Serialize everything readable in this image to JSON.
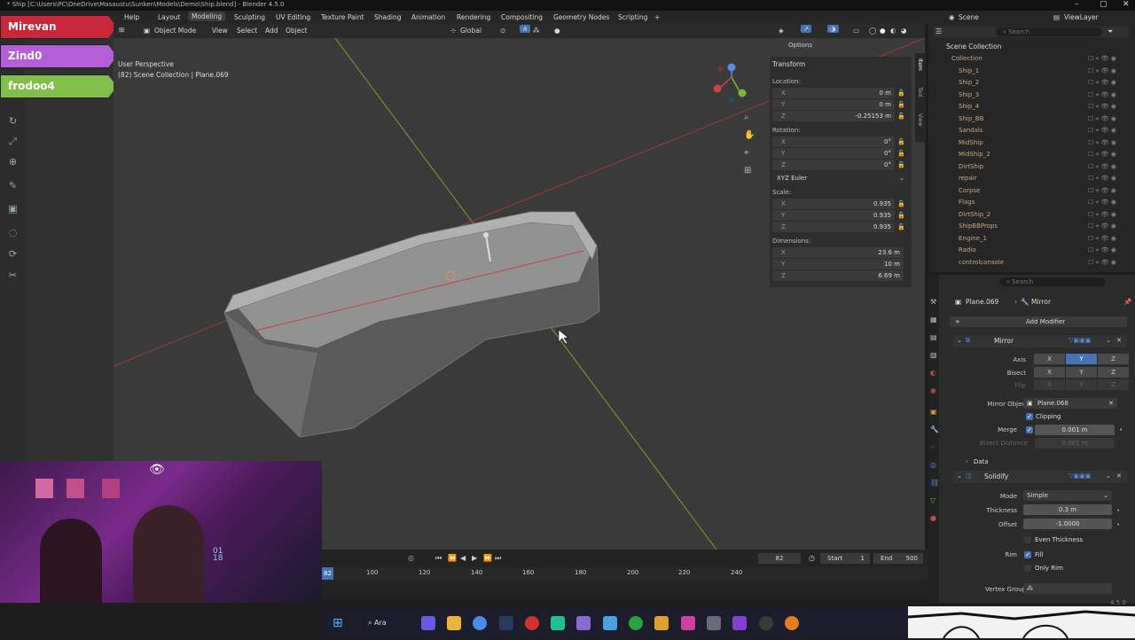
{
  "window": {
    "title": "* Ship [C:\\Users\\PC\\OneDrive\\Masaustu\\Sunken\\Models\\Demo\\Ship.blend] - Blender 4.5.0"
  },
  "menu": {
    "help": "Help",
    "workspaces": [
      "Layout",
      "Modeling",
      "Sculpting",
      "UV Editing",
      "Texture Paint",
      "Shading",
      "Animation",
      "Rendering",
      "Compositing",
      "Geometry Nodes",
      "Scripting"
    ],
    "add_tab": "+",
    "scene": "Scene",
    "view_layer": "ViewLayer"
  },
  "viewport_header": {
    "mode": "Object Mode",
    "view": "View",
    "select": "Select",
    "add": "Add",
    "object": "Object",
    "orientation": "Global",
    "options": "Options"
  },
  "viewport": {
    "perspective": "User Perspective",
    "collection_info": "(82) Scene Collection | Plane.069"
  },
  "stream_tags": [
    {
      "label": "Mirevan",
      "color": "#c8283a"
    },
    {
      "label": "Zind0",
      "color": "#b45fd8"
    },
    {
      "label": "frodoo4",
      "color": "#7fbf4a"
    }
  ],
  "transform": {
    "title": "Transform",
    "location_label": "Location:",
    "location": {
      "x": "0 m",
      "y": "0 m",
      "z": "-0.25153 m"
    },
    "rotation_label": "Rotation:",
    "rotation": {
      "x": "0°",
      "y": "0°",
      "z": "0°"
    },
    "rotation_mode": "XYZ Euler",
    "scale_label": "Scale:",
    "scale": {
      "x": "0.935",
      "y": "0.935",
      "z": "0.935"
    },
    "dimensions_label": "Dimensions:",
    "dimensions": {
      "x": "23.6 m",
      "y": "10 m",
      "z": "6.69 m"
    },
    "axes": [
      "X",
      "Y",
      "Z"
    ]
  },
  "side_tabs": [
    "Item",
    "Tool",
    "View"
  ],
  "outliner": {
    "search_placeholder": "Search",
    "root": "Scene Collection",
    "items": [
      "Collection",
      "Ship_1",
      "Ship_2",
      "Ship_3",
      "Ship_4",
      "Ship_BB",
      "Sandals",
      "MidShip",
      "MidShip_2",
      "DirtShip",
      "repair",
      "Corpse",
      "Flags",
      "DirtShip_2",
      "ShipBBProps",
      "Engine_1",
      "Radio",
      "controlconsole"
    ]
  },
  "properties": {
    "search_placeholder": "Search",
    "object_name": "Plane.069",
    "modifier_breadcrumb": "Mirror",
    "add_modifier": "Add Modifier",
    "mirror": {
      "name": "Mirror",
      "axis_label": "Axis",
      "bisect_label": "Bisect",
      "flip_label": "Flip",
      "mirror_object_label": "Mirror Object",
      "mirror_object": "Plane.068",
      "clipping": "Clipping",
      "merge_label": "Merge",
      "merge_value": "0.001 m",
      "bisect_distance_label": "Bisect Distance",
      "bisect_distance": "0.001 m",
      "data": "Data"
    },
    "solidify": {
      "name": "Solidify",
      "mode_label": "Mode",
      "mode": "Simple",
      "thickness_label": "Thickness",
      "thickness": "0.3 m",
      "offset_label": "Offset",
      "offset": "-1.0000",
      "even_thickness": "Even Thickness",
      "rim_label": "Rim",
      "fill": "Fill",
      "only_rim": "Only Rim",
      "vertex_group_label": "Vertex Group"
    }
  },
  "timeline": {
    "current_frame": "82",
    "start_label": "Start",
    "start": "1",
    "end_label": "End",
    "end": "500",
    "ruler": [
      "82",
      "100",
      "120",
      "140",
      "160",
      "180",
      "200",
      "220",
      "240"
    ]
  },
  "taskbar": {
    "search": "Ara"
  },
  "webcam": {
    "clock": "01\n18"
  },
  "version": "4.5.0"
}
